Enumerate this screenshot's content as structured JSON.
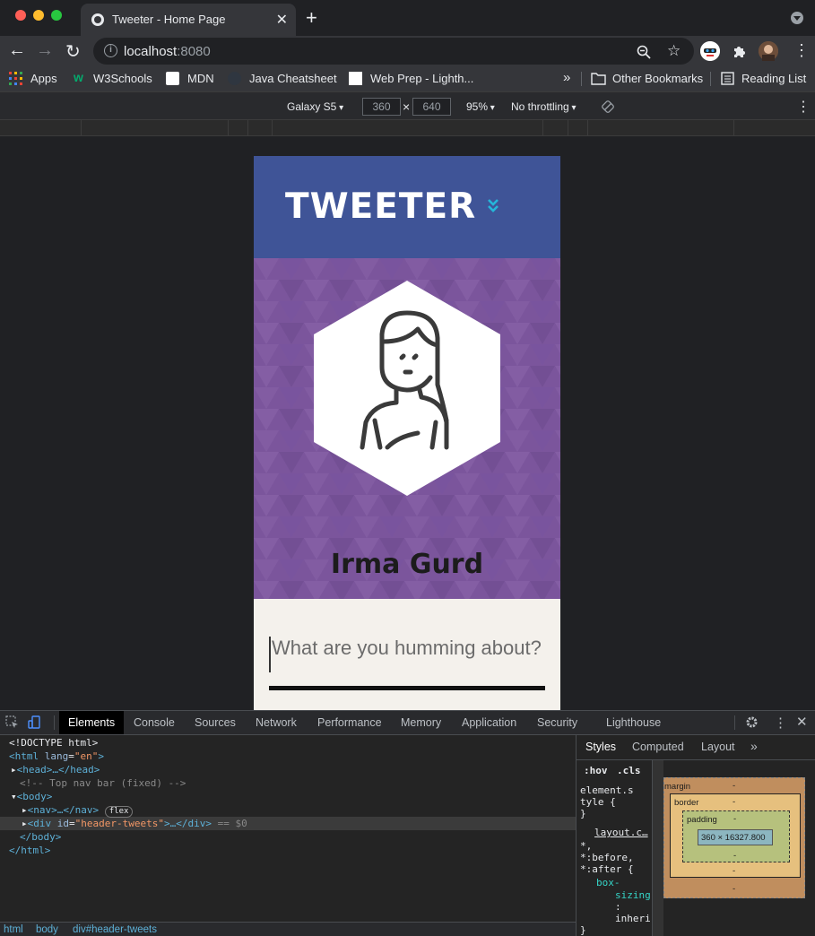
{
  "browser": {
    "tab_title": "Tweeter - Home Page",
    "tab_close": "✕",
    "new_tab": "+",
    "url_host": "localhost",
    "url_port": ":8080",
    "bookmarks": {
      "apps": "Apps",
      "w3schools": "W3Schools",
      "mdn": "MDN",
      "java": "Java Cheatsheet",
      "webprep": "Web Prep - Lighth...",
      "more": "»",
      "other": "Other Bookmarks",
      "reading": "Reading List"
    }
  },
  "device_toolbar": {
    "device": "Galaxy S5",
    "width": "360",
    "times": "×",
    "height": "640",
    "zoom": "95%",
    "throttle": "No throttling"
  },
  "page": {
    "brand": "TWEETER",
    "user_name": "Irma Gurd",
    "composer_placeholder": "What are you humming about?"
  },
  "devtools": {
    "tabs": [
      "Elements",
      "Console",
      "Sources",
      "Network",
      "Performance",
      "Memory",
      "Application",
      "Security",
      "Lighthouse"
    ],
    "dom": {
      "doctype": "<!DOCTYPE html>",
      "html_open_tag": "<html",
      "html_attr": "lang",
      "html_attr_val": "\"en\"",
      "head": "<head>…</head>",
      "comment": "<!-- Top nav bar (fixed) -->",
      "body_open": "<body>",
      "nav": "<nav>…</nav>",
      "nav_badge": "flex",
      "div_open": "<div",
      "div_attr": "id",
      "div_attr_val": "\"header-tweets\"",
      "div_close": ">…</div>",
      "div_marker": "== $0",
      "body_close": "</body>",
      "html_close": "</html>"
    },
    "breadcrumbs": [
      "html",
      "body",
      "div#header-tweets"
    ],
    "styles_tabs": [
      "Styles",
      "Computed",
      "Layout",
      "»"
    ],
    "filter": {
      "hov": ":hov",
      "cls": ".cls"
    },
    "rules": {
      "element_style_1": "element.s",
      "element_style_2": "tyle {",
      "close": "}",
      "source": "layout.c…",
      "selector_1": "*,",
      "selector_2": "*:before,",
      "selector_3": "*:after {",
      "prop_1": "box-",
      "prop_2": "sizing",
      "colon": ":",
      "value": "inheri",
      "close2": "}"
    },
    "box_model": {
      "margin": "margin",
      "border": "border",
      "padding": "padding",
      "content": "360 × 16327.800",
      "dash": "-"
    }
  }
}
